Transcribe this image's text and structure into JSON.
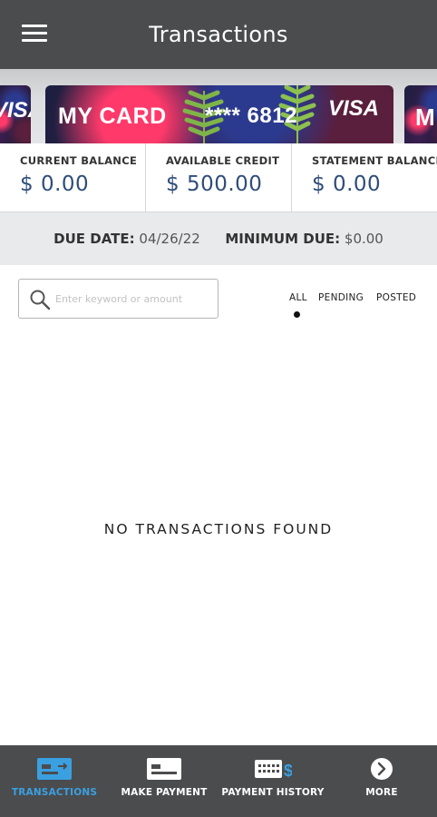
{
  "header": {
    "title": "Transactions",
    "menu_icon": "hamburger-menu-icon"
  },
  "cards": {
    "main_label": "MY CARD",
    "main_number": "**** 6812",
    "network": "VISA",
    "left_network": "VISA",
    "right_label": "M"
  },
  "balances": [
    {
      "label": "CURRENT BALANCE",
      "value": "$ 0.00"
    },
    {
      "label": "AVAILABLE CREDIT",
      "value": "$ 500.00"
    },
    {
      "label": "STATEMENT BALANCE",
      "value": "$ 0.00"
    }
  ],
  "due": {
    "due_label": "DUE DATE:",
    "due_value": "04/26/22",
    "min_label": "MINIMUM DUE:",
    "min_value": "$0.00"
  },
  "search": {
    "placeholder": "Enter keyword or amount",
    "value": "",
    "icon": "search-icon"
  },
  "filters": {
    "selected": "ALL",
    "all": "ALL",
    "pending": "PENDING",
    "posted": "POSTED"
  },
  "empty_message": "NO TRANSACTIONS FOUND",
  "tabbar": {
    "active": "TRANSACTIONS",
    "active_color": "#3aa0e0",
    "items": [
      {
        "label": "TRANSACTIONS",
        "icon": "transactions-card-icon"
      },
      {
        "label": "MAKE PAYMENT",
        "icon": "payment-card-icon"
      },
      {
        "label": "PAYMENT HISTORY",
        "icon": "payment-history-icon"
      },
      {
        "label": "MORE",
        "icon": "chevron-right-circle-icon"
      }
    ]
  },
  "colors": {
    "header_bg": "#4b4c4e",
    "balance_value": "#2f4d7a",
    "due_bg": "#e9eaec"
  }
}
